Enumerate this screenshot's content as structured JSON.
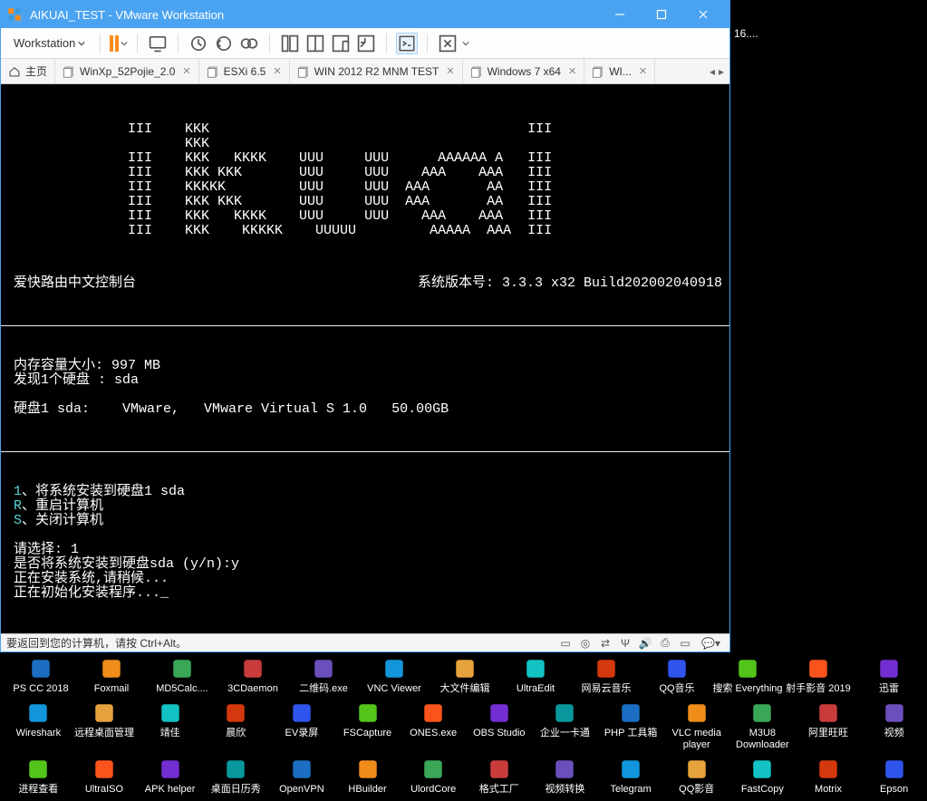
{
  "window": {
    "title": "AIKUAI_TEST - VMware Workstation",
    "menu_label": "Workstation"
  },
  "tabs": {
    "home": "主页",
    "items": [
      "WinXp_52Pojie_2.0",
      "ESXi 6.5",
      "WIN 2012 R2 MNM TEST",
      "Windows 7 x64",
      "WI..."
    ]
  },
  "console": {
    "ascii": "              III    KKK                                       III\n                     KKK\n              III    KKK   KKKK    UUU     UUU      AAAAAA A   III\n              III    KKK KKK       UUU     UUU    AAA    AAA   III\n              III    KKKKK         UUU     UUU  AAA       AA   III\n              III    KKK KKK       UUU     UUU  AAA       AA   III\n              III    KKK   KKKK    UUU     UUU    AAA    AAA   III\n              III    KKK    KKKKK    UUUUU         AAAAA  AAA  III",
    "header_left": "爱快路由中文控制台",
    "header_right": "系统版本号: 3.3.3 x32 Build202002040918",
    "mem_line": "内存容量大小: 997 MB",
    "disk_found": "发现1个硬盘 : sda",
    "disk_info": "硬盘1 sda:    VMware,   VMware Virtual S 1.0   50.00GB",
    "opt1_key": "1",
    "opt1_txt": "、将系统安装到硬盘1 sda",
    "opt2_key": "R",
    "opt2_txt": "、重启计算机",
    "opt3_key": "S",
    "opt3_txt": "、关闭计算机",
    "prompt": "请选择: 1",
    "confirm": "是否将系统安装到硬盘sda (y/n):y",
    "installing": "正在安装系统,请稍候...",
    "init": "正在初始化安装程序..._"
  },
  "statusbar": {
    "hint": "要返回到您的计算机，请按 Ctrl+Alt。"
  },
  "side_text": "16....",
  "desktop": {
    "row1": [
      "PS CC 2018",
      "Foxmail",
      "MD5Calc....",
      "3CDaemon",
      "二维码.exe",
      "VNC Viewer",
      "大文件编辑",
      "UltraEdit",
      "网易云音乐",
      "QQ音乐",
      "搜索 Everything",
      "射手影音 2019",
      "迅雷"
    ],
    "row2": [
      "Wireshark",
      "远程桌面管理",
      "靖佳",
      "晨欣",
      "EV录屏",
      "FSCapture",
      "ONES.exe",
      "OBS Studio",
      "企业一卡通",
      "PHP 工具箱",
      "VLC media player",
      "M3U8 Downloader",
      "阿里旺旺",
      "视频"
    ],
    "row3": [
      "进程查看",
      "UltraISO",
      "APK helper",
      "桌面日历秀",
      "OpenVPN",
      "HBuilder",
      "UlordCore",
      "格式工厂",
      "视频转换",
      "Telegram",
      "QQ影音",
      "FastCopy",
      "Motrix",
      "Epson"
    ]
  }
}
